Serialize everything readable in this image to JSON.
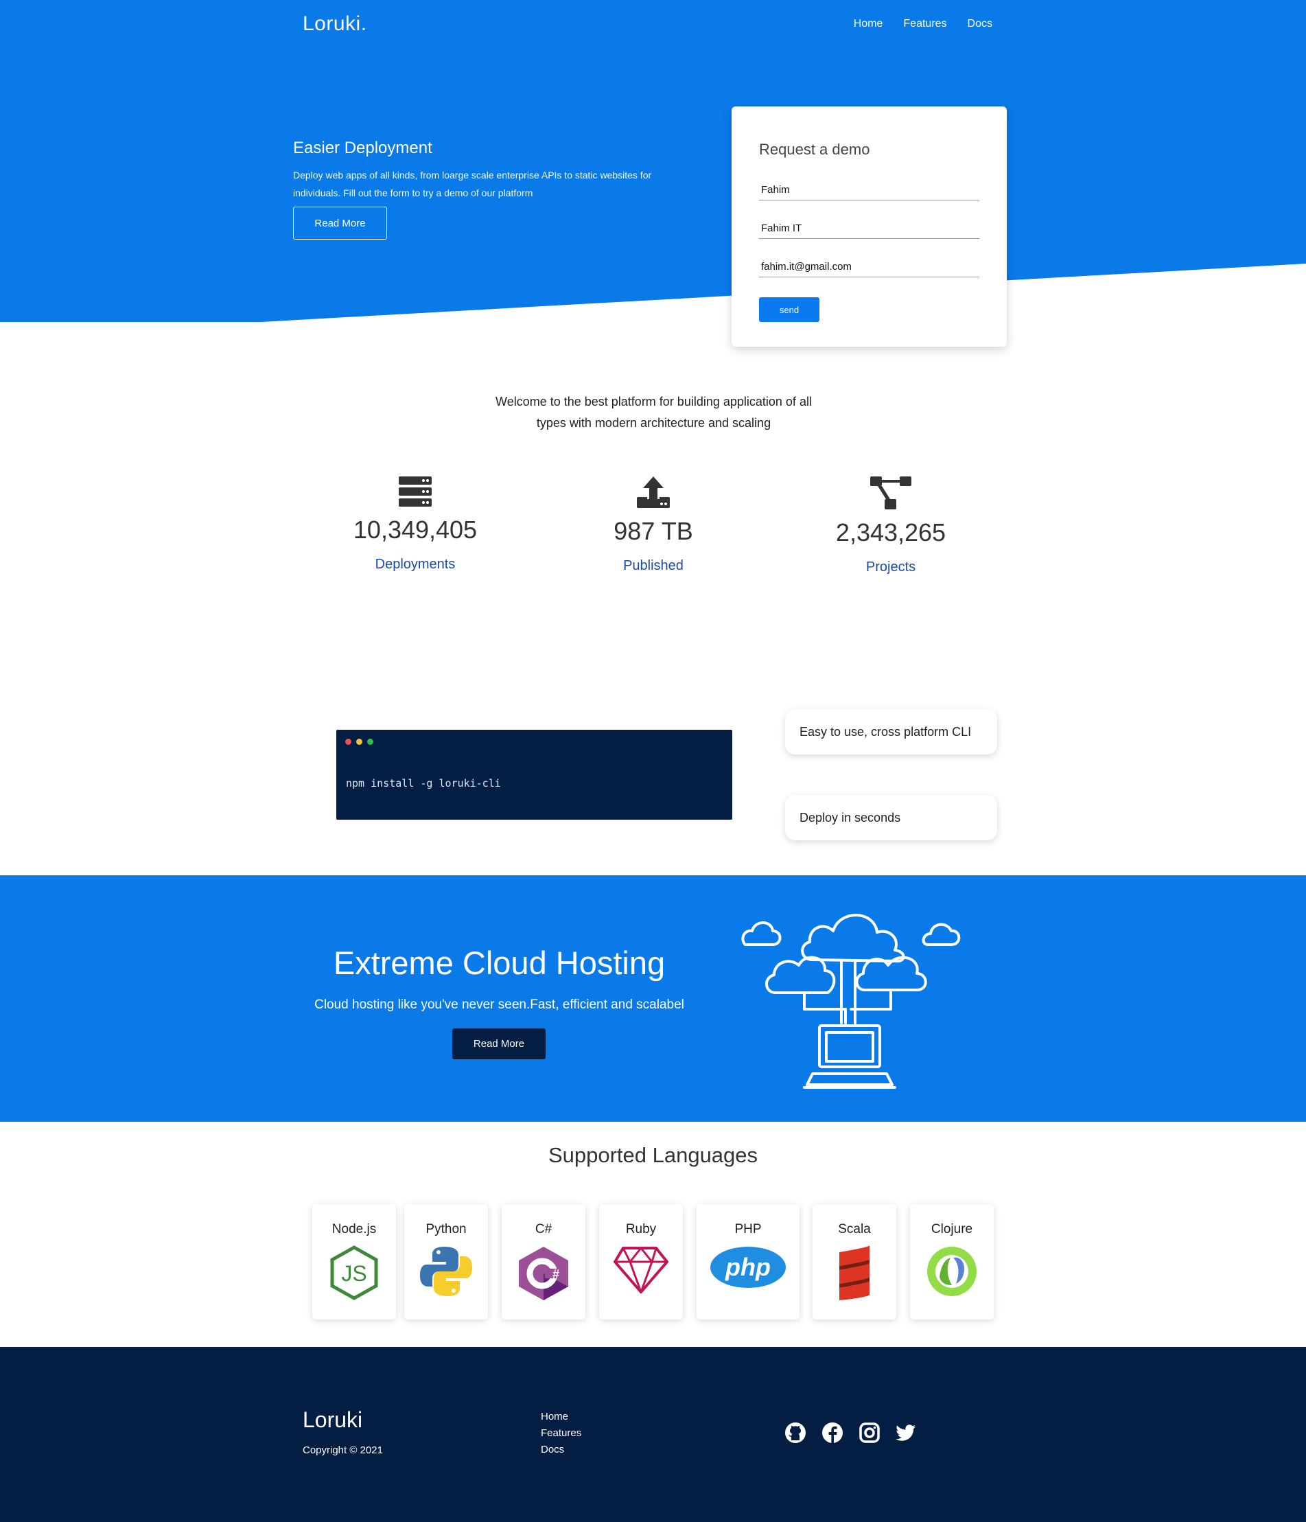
{
  "header": {
    "brand": "Loruki.",
    "nav": [
      "Home",
      "Features",
      "Docs"
    ]
  },
  "hero": {
    "title": "Easier Deployment",
    "text": "Deploy web apps of all kinds, from loarge scale enterprise APIs to static websites for individuals. Fill out the form to try a demo of our platform",
    "button": "Read More"
  },
  "demo_form": {
    "title": "Request a demo",
    "name_value": "Fahim",
    "company_value": "Fahim IT",
    "email_value": "fahim.it@gmail.com",
    "send_label": "send"
  },
  "welcome": {
    "text": "Welcome to the best platform for building application of all types with modern architecture and scaling"
  },
  "stats": [
    {
      "icon": "server-icon",
      "value": "10,349,405",
      "label": "Deployments"
    },
    {
      "icon": "upload-icon",
      "value": "987 TB",
      "label": "Published"
    },
    {
      "icon": "project-diagram-icon",
      "value": "2,343,265",
      "label": "Projects"
    }
  ],
  "terminal": {
    "command": "npm install -g loruki-cli",
    "dot_colors": [
      "#ef4f4f",
      "#f1c232",
      "#2fbf48"
    ]
  },
  "features": [
    "Easy to use, cross platform CLI",
    "Deploy in seconds"
  ],
  "cloud": {
    "title": "Extreme Cloud Hosting",
    "text": "Cloud hosting like you've never seen.Fast, efficient and scalabel",
    "button": "Read More"
  },
  "languages": {
    "title": "Supported Languages",
    "items": [
      "Node.js",
      "Python",
      "C#",
      "Ruby",
      "PHP",
      "Scala",
      "Clojure"
    ]
  },
  "footer": {
    "brand": "Loruki",
    "copyright": "Copyright © 2021",
    "links": [
      "Home",
      "Features",
      "Docs"
    ],
    "social": [
      "github-icon",
      "facebook-icon",
      "instagram-icon",
      "twitter-icon"
    ]
  },
  "colors": {
    "primary": "#0a7ae9",
    "dark": "#031e42",
    "stat_label": "#1b4aa8"
  }
}
